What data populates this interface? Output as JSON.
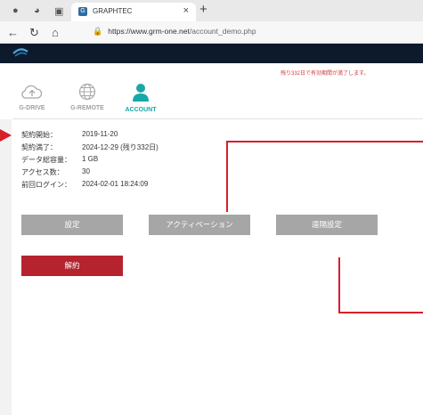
{
  "browser": {
    "tab_title": "GRAPHTEC",
    "tab_icon": "G",
    "url_domain": "https://www.grm-one.net",
    "url_path": "/account_demo.php"
  },
  "site": {
    "expiry_notice": "残り332日で有効期間が満了します。"
  },
  "nav": {
    "drive": "G-DRIVE",
    "remote": "G-REMOTE",
    "account": "ACCOUNT"
  },
  "account_info": [
    {
      "label": "契約開始：",
      "value": "2019-11-20"
    },
    {
      "label": "契約満了：",
      "value": "2024-12-29 (残り332日)"
    },
    {
      "label": "データ総容量：",
      "value": "1 GB"
    },
    {
      "label": "アクセス数：",
      "value": "30"
    },
    {
      "label": "前回ログイン：",
      "value": "2024-02-01 18:24:09"
    }
  ],
  "buttons": {
    "settings": "設定",
    "activation": "アクティベーション",
    "remote_settings": "遠隔設定",
    "cancel": "解約"
  },
  "colors": {
    "accent_teal": "#1aa7a7",
    "cancel_red": "#b5232e",
    "annotation_red": "#d71e2b",
    "header_navy": "#0c1a2c"
  }
}
